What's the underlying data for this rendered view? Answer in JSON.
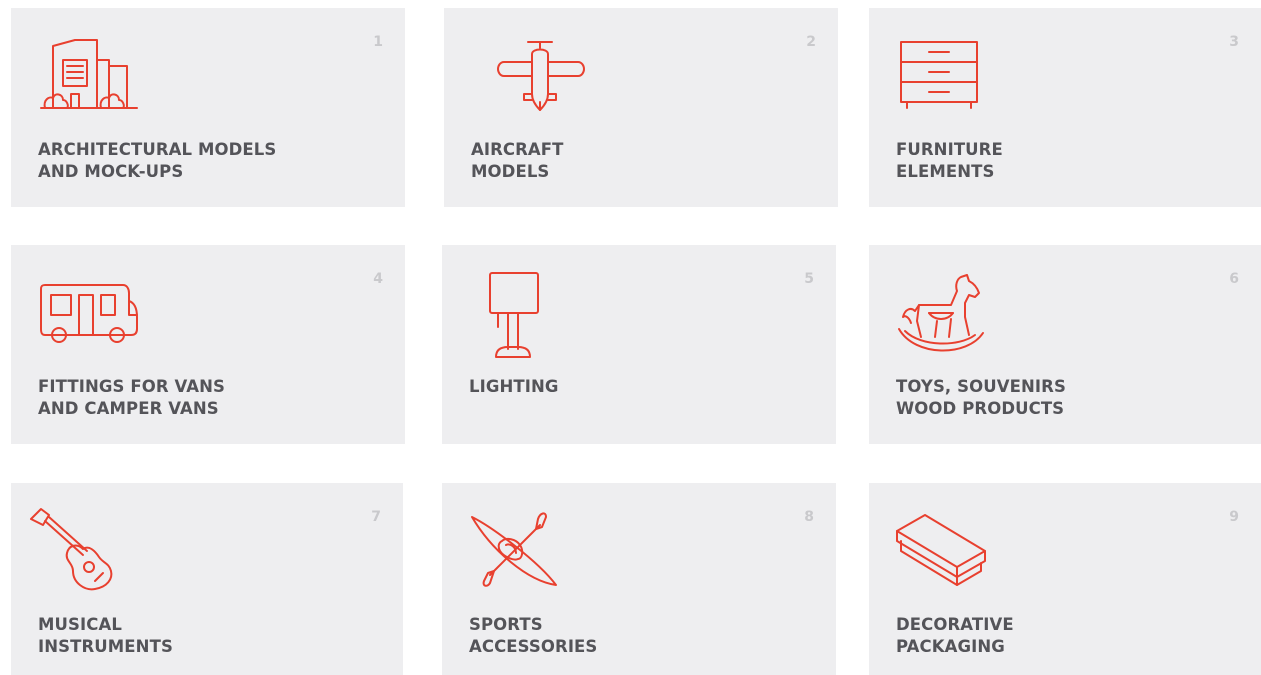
{
  "accent_color": "#e8402f",
  "cards": [
    {
      "number": "1",
      "icon": "building-icon",
      "line1": "ARCHITECTURAL MODELS",
      "line2": "AND MOCK-UPS"
    },
    {
      "number": "2",
      "icon": "airplane-icon",
      "line1": "AIRCRAFT",
      "line2": "MODELS"
    },
    {
      "number": "3",
      "icon": "dresser-icon",
      "line1": "FURNITURE",
      "line2": "ELEMENTS"
    },
    {
      "number": "4",
      "icon": "camper-van-icon",
      "line1": "FITTINGS FOR VANS",
      "line2": "AND CAMPER VANS"
    },
    {
      "number": "5",
      "icon": "lamp-icon",
      "line1": "LIGHTING",
      "line2": ""
    },
    {
      "number": "6",
      "icon": "rocking-horse-icon",
      "line1": "TOYS, SOUVENIRS",
      "line2": "WOOD PRODUCTS"
    },
    {
      "number": "7",
      "icon": "guitar-icon",
      "line1": "MUSICAL",
      "line2": "INSTRUMENTS"
    },
    {
      "number": "8",
      "icon": "kayak-icon",
      "line1": "SPORTS",
      "line2": "ACCESSORIES"
    },
    {
      "number": "9",
      "icon": "gift-box-icon",
      "line1": "DECORATIVE",
      "line2": "PACKAGING"
    }
  ]
}
